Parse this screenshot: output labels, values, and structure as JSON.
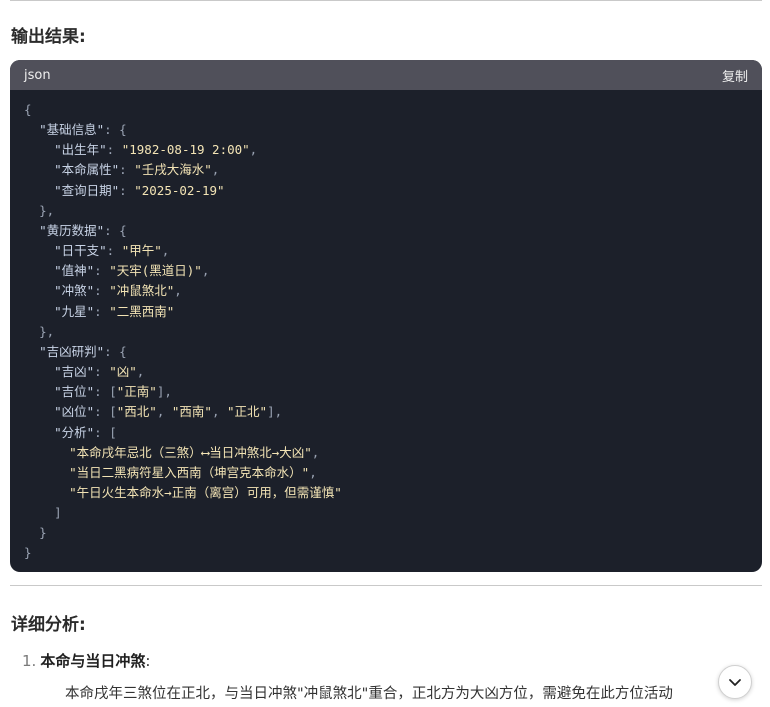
{
  "section_output_title": "输出结果:",
  "code": {
    "lang": "json",
    "copy_label": "复制",
    "line_open": "{",
    "g1_key": "\"基础信息\"",
    "g1_f1_key": "\"出生年\"",
    "g1_f1_val": "\"1982-08-19 2:00\"",
    "g1_f2_key": "\"本命属性\"",
    "g1_f2_val": "\"壬戌大海水\"",
    "g1_f3_key": "\"查询日期\"",
    "g1_f3_val": "\"2025-02-19\"",
    "g2_key": "\"黄历数据\"",
    "g2_f1_key": "\"日干支\"",
    "g2_f1_val": "\"甲午\"",
    "g2_f2_key": "\"值神\"",
    "g2_f2_val": "\"天牢(黑道日)\"",
    "g2_f3_key": "\"冲煞\"",
    "g2_f3_val": "\"冲鼠煞北\"",
    "g2_f4_key": "\"九星\"",
    "g2_f4_val": "\"二黑西南\"",
    "g3_key": "\"吉凶研判\"",
    "g3_f1_key": "\"吉凶\"",
    "g3_f1_val": "\"凶\"",
    "g3_f2_key": "\"吉位\"",
    "g3_f2_val": "\"正南\"",
    "g3_f3_key": "\"凶位\"",
    "g3_f3_v1": "\"西北\"",
    "g3_f3_v2": "\"西南\"",
    "g3_f3_v3": "\"正北\"",
    "g3_f4_key": "\"分析\"",
    "a1": "\"本命戌年忌北（三煞）⟷当日冲煞北→大凶\"",
    "a2": "\"当日二黑病符星入西南（坤宫克本命水）\"",
    "a3": "\"午日火生本命水→正南（离宫）可用，但需谨慎\"",
    "line_close": "}"
  },
  "section_analysis_title": "详细分析:",
  "list_item_1": {
    "number": "1.",
    "title": "本命与当日冲煞",
    "colon": ":"
  },
  "paragraph_1": "本命戌年三煞位在正北，与当日冲煞\"冲鼠煞北\"重合，正北方为大凶方位，需避免在此方位活动",
  "fab_icon": "chevron-down-icon"
}
